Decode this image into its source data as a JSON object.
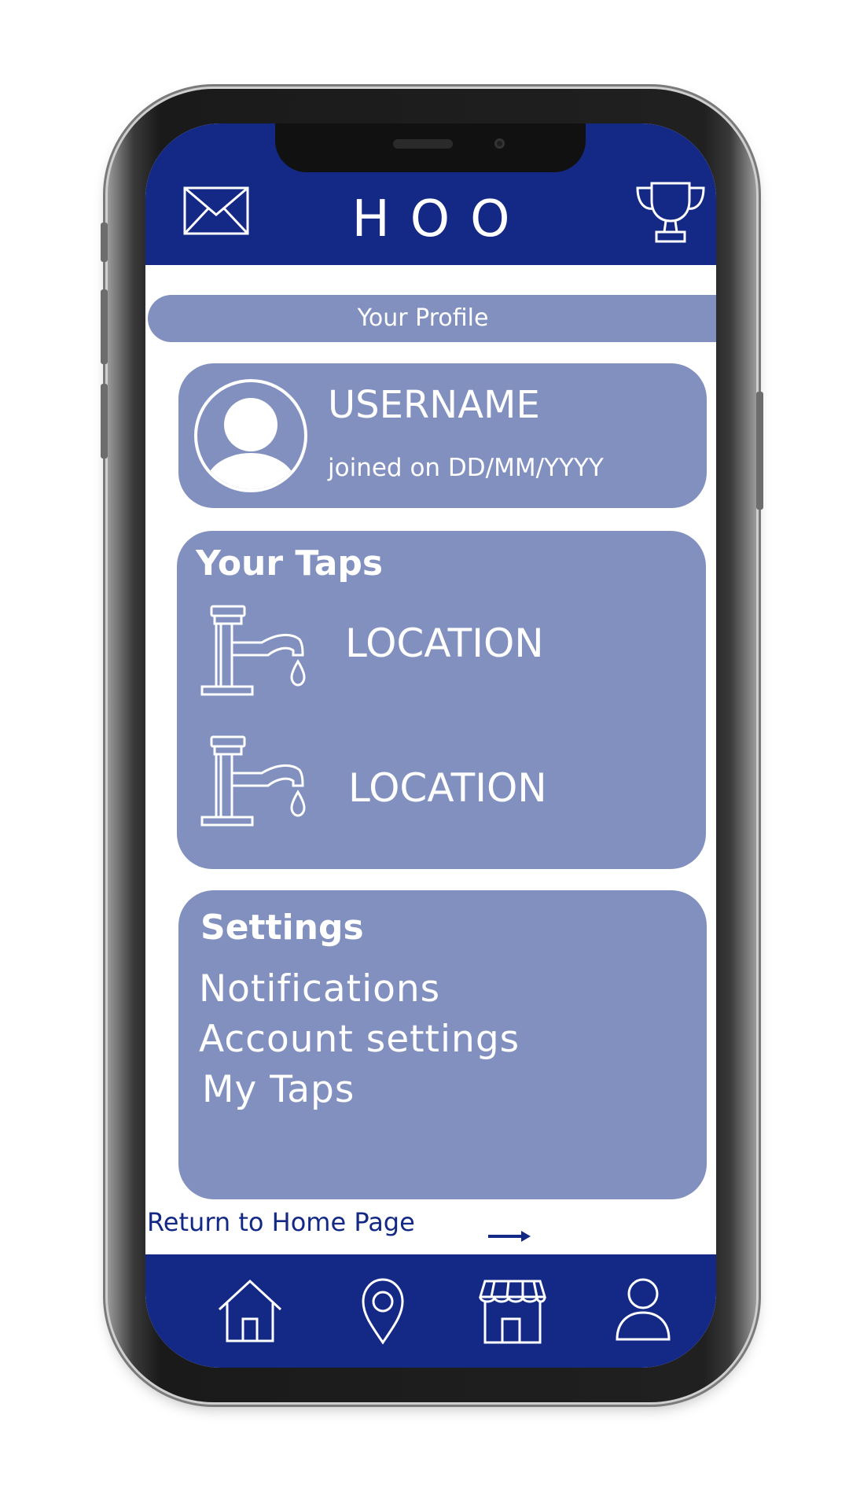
{
  "header": {
    "brand": "HOO",
    "left_icon": "mail-icon",
    "right_icon": "trophy-icon"
  },
  "profile_banner": {
    "label": "Your Profile"
  },
  "user": {
    "username": "USERNAME",
    "joined": "joined on DD/MM/YYYY",
    "avatar_icon": "user-avatar-icon"
  },
  "taps": {
    "title": "Your Taps",
    "items": [
      {
        "label": "LOCATION",
        "icon": "tap-icon"
      },
      {
        "label": "LOCATION",
        "icon": "tap-icon"
      }
    ]
  },
  "settings": {
    "title": "Settings",
    "items": [
      {
        "label": "Notifications"
      },
      {
        "label": "Account settings"
      },
      {
        "label": "My Taps"
      }
    ]
  },
  "return_link": {
    "label": "Return to Home Page",
    "icon": "arrow-right-icon"
  },
  "bottom_nav": [
    {
      "icon": "home-icon"
    },
    {
      "icon": "map-pin-icon"
    },
    {
      "icon": "store-icon"
    },
    {
      "icon": "profile-icon"
    }
  ],
  "colors": {
    "primary": "#142985",
    "card": "#8290c0",
    "text_on_card": "#ffffff"
  }
}
